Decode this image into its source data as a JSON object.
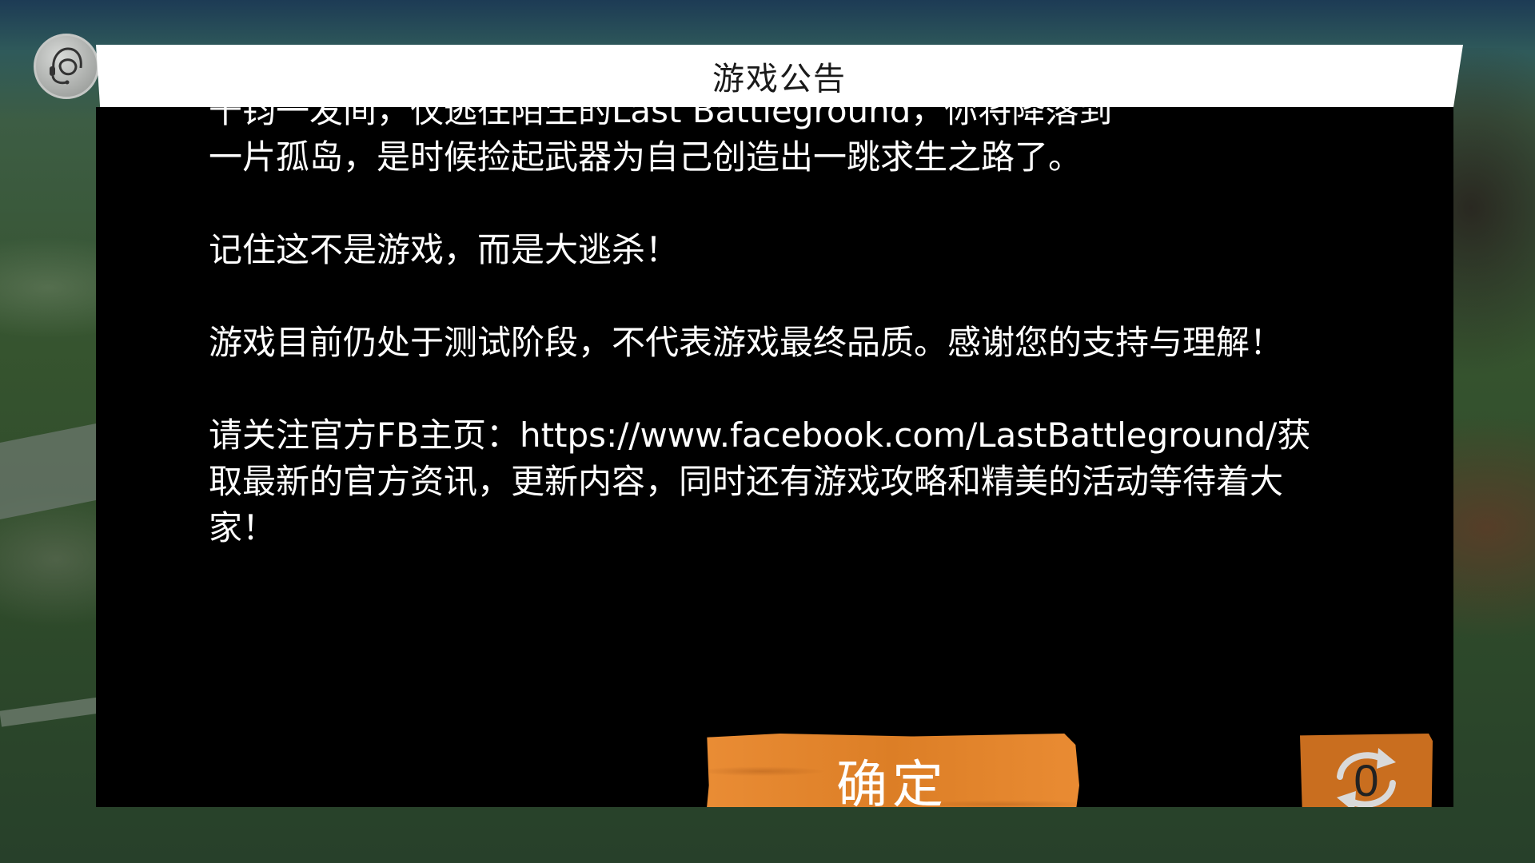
{
  "dialog": {
    "title": "游戏公告",
    "paragraphs": [
      "千钧一发间，仅逃往陌生的Last Battleground，你将降落到",
      "一片孤岛，是时候捡起武器为自己创造出一跳求生之路了。",
      "记住这不是游戏，而是大逃杀！",
      "游戏目前仍处于测试阶段，不代表游戏最终品质。感谢您的支持与理解！",
      "请关注官方FB主页：https://www.facebook.com/LastBattleground/获取最新的官方资讯，更新内容，同时还有游戏攻略和精美的活动等待着大家！"
    ]
  },
  "buttons": {
    "confirm_label": "确定",
    "refresh_count": "0"
  },
  "icons": {
    "support": "headset-support-icon",
    "refresh": "refresh-icon"
  },
  "colors": {
    "accent": "#e88528",
    "accent_dark": "#c96e1f",
    "header_bg": "#ffffff",
    "body_bg": "#000000",
    "text": "#ffffff"
  }
}
